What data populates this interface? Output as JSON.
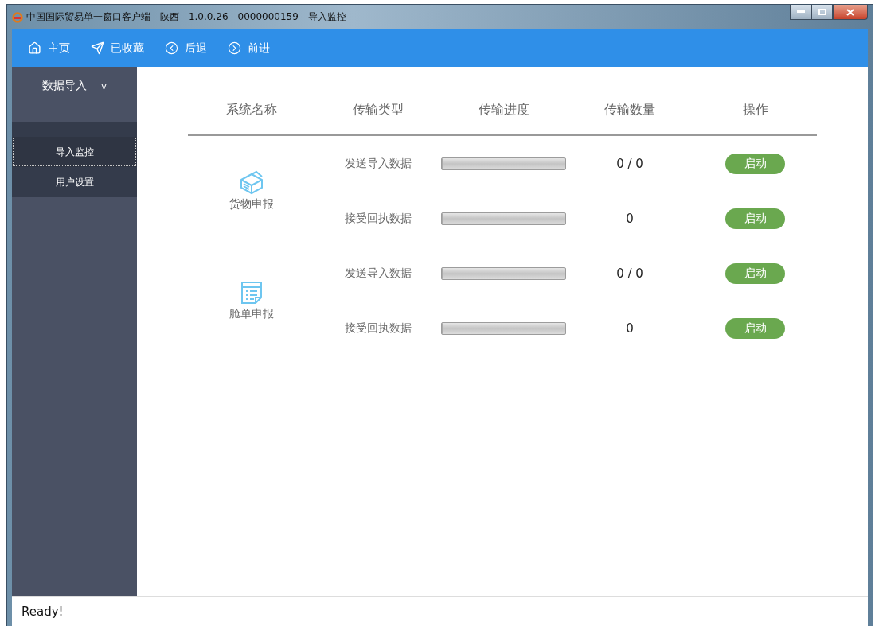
{
  "window": {
    "title": "中国国际贸易单一窗口客户端 - 陕西 - 1.0.0.26 - 0000000159 - 导入监控"
  },
  "toolbar": [
    {
      "label": "主页"
    },
    {
      "label": "已收藏"
    },
    {
      "label": "后退"
    },
    {
      "label": "前进"
    }
  ],
  "sidebar": {
    "heading": "数据导入",
    "caret": "v",
    "expanded": true,
    "items": [
      {
        "label": "导入监控",
        "selected": true
      },
      {
        "label": "用户设置",
        "selected": false
      }
    ]
  },
  "table": {
    "columns": [
      "系统名称",
      "传输类型",
      "传输进度",
      "传输数量",
      "操作"
    ],
    "groups": [
      {
        "name": "货物申报",
        "rows": [
          {
            "type": "发送导入数据",
            "level": 0,
            "count": "0 / 0",
            "action": "启动"
          },
          {
            "type": "接受回执数据",
            "level": 0,
            "count": "0",
            "action": "启动"
          }
        ]
      },
      {
        "name": "舱单申报",
        "rows": [
          {
            "type": "发送导入数据",
            "level": 0,
            "count": "0 / 0",
            "action": "启动"
          },
          {
            "type": "接受回执数据",
            "level": 0,
            "count": "0",
            "action": "启动"
          }
        ]
      }
    ]
  },
  "status_bar": {
    "text": "Ready!"
  }
}
